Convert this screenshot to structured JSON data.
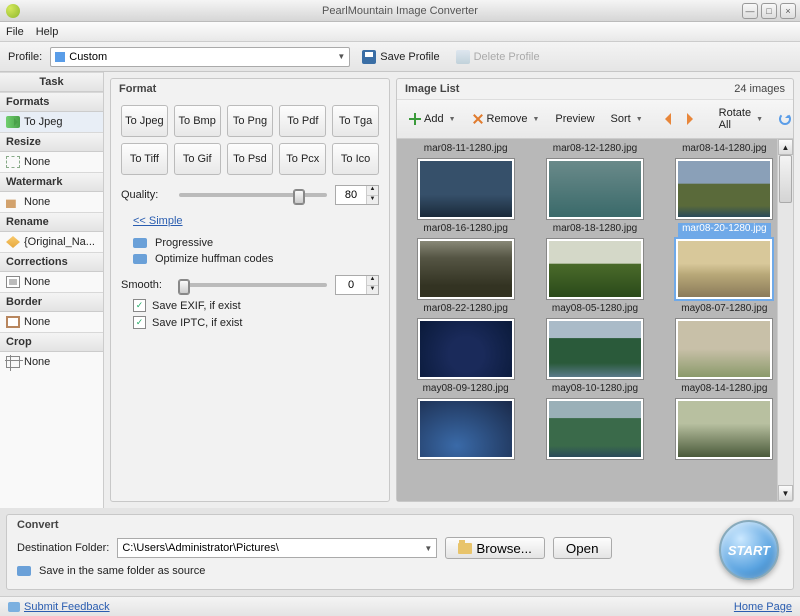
{
  "window": {
    "title": "PearlMountain Image Converter"
  },
  "menu": {
    "file": "File",
    "help": "Help"
  },
  "profile": {
    "label": "Profile:",
    "value": "Custom",
    "save": "Save Profile",
    "delete": "Delete Profile"
  },
  "sidebar": {
    "task_hdr": "Task",
    "formats_hdr": "Formats",
    "formats_val": "To Jpeg",
    "resize_hdr": "Resize",
    "resize_val": "None",
    "wm_hdr": "Watermark",
    "wm_val": "None",
    "rename_hdr": "Rename",
    "rename_val": "{Original_Na...",
    "corr_hdr": "Corrections",
    "corr_val": "None",
    "border_hdr": "Border",
    "border_val": "None",
    "crop_hdr": "Crop",
    "crop_val": "None"
  },
  "format": {
    "title": "Format",
    "btns": [
      "To Jpeg",
      "To Bmp",
      "To Png",
      "To Pdf",
      "To Tga",
      "To Tiff",
      "To Gif",
      "To Psd",
      "To Pcx",
      "To Ico"
    ],
    "quality_label": "Quality:",
    "quality": "80",
    "simple": "<< Simple",
    "progressive": "Progressive",
    "huffman": "Optimize huffman codes",
    "smooth_label": "Smooth:",
    "smooth": "0",
    "exif": "Save EXIF, if exist",
    "iptc": "Save IPTC, if exist"
  },
  "imagelist": {
    "title": "Image List",
    "count": "24 images",
    "add": "Add",
    "remove": "Remove",
    "preview": "Preview",
    "sort": "Sort",
    "rotate": "Rotate All",
    "items": [
      "mar08-11-1280.jpg",
      "mar08-12-1280.jpg",
      "mar08-14-1280.jpg",
      "mar08-16-1280.jpg",
      "mar08-18-1280.jpg",
      "mar08-20-1280.jpg",
      "mar08-22-1280.jpg",
      "may08-05-1280.jpg",
      "may08-07-1280.jpg",
      "may08-09-1280.jpg",
      "may08-10-1280.jpg",
      "may08-14-1280.jpg"
    ],
    "selected": 5
  },
  "convert": {
    "title": "Convert",
    "dest_label": "Destination Folder:",
    "dest": "C:\\Users\\Administrator\\Pictures\\",
    "browse": "Browse...",
    "open": "Open",
    "samefolder": "Save in the same folder as source",
    "start": "START"
  },
  "status": {
    "feedback": "Submit Feedback",
    "home": "Home Page"
  }
}
